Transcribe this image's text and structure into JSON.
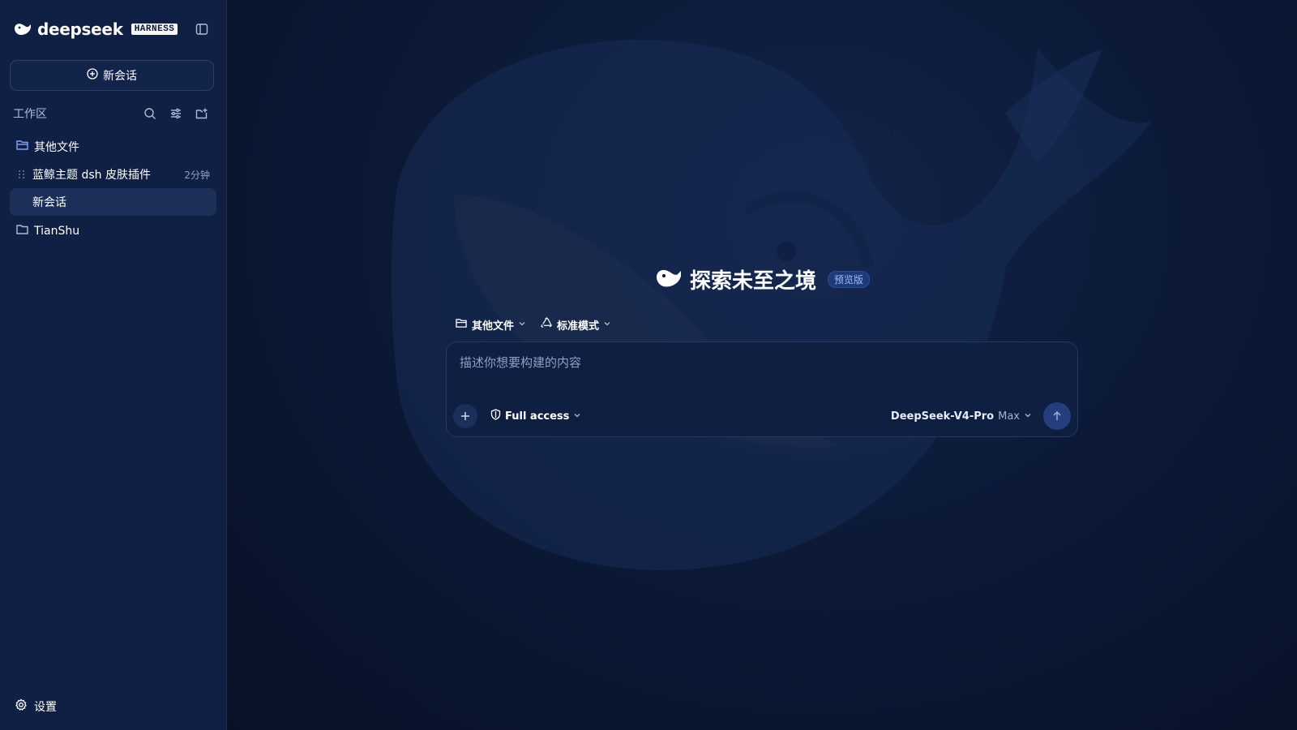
{
  "brand": {
    "name": "deepseek",
    "badge": "HARNESS",
    "logo_icon": "whale-icon"
  },
  "sidebar": {
    "new_chat_label": "新会话",
    "workspace_title": "工作区",
    "tools": [
      "search-icon",
      "filter-icon",
      "new-folder-icon"
    ],
    "tree": {
      "folder1": {
        "label": "其他文件",
        "icon": "folder-open-icon"
      },
      "items": [
        {
          "label": "蓝鲸主题 dsh 皮肤插件",
          "time": "2分钟"
        },
        {
          "label": "新会话",
          "time": ""
        }
      ],
      "folder2": {
        "label": "TianShu",
        "icon": "folder-icon"
      }
    },
    "settings_label": "设置"
  },
  "main": {
    "hero_title": "探索未至之境",
    "hero_badge": "预览版",
    "folder_selector": "其他文件",
    "mode_selector": "标准模式",
    "input_placeholder": "描述你想要构建的内容",
    "access_label": "Full access",
    "model_name": "DeepSeek-V4-Pro",
    "model_level": "Max"
  },
  "colors": {
    "sidebar_bg": "#102044",
    "main_bg": "#0c1a38",
    "accent": "#243e7e",
    "badge_text": "#9fbaff"
  }
}
